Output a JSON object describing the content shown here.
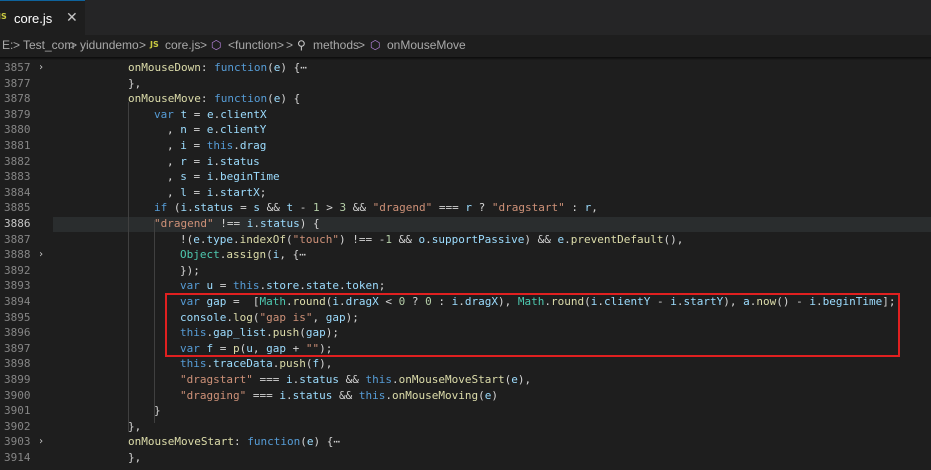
{
  "tab": {
    "badge": "JS",
    "label": "core.js",
    "close": "✕"
  },
  "breadcrumb": {
    "drive": "E:",
    "sep": ">",
    "folder1": "Test_com",
    "folder2": "yidundemo",
    "file_badge": "JS",
    "file": "core.js",
    "sym1": "<function>",
    "sym2": "methods",
    "sym3": "onMouseMove"
  },
  "lines": [
    {
      "n": "3857",
      "fold": "›",
      "code": "onMouseDown: function(e) {⋯"
    },
    {
      "n": "3877",
      "fold": "",
      "code": "},"
    },
    {
      "n": "3878",
      "fold": "",
      "code": "onMouseMove: function(e) {"
    },
    {
      "n": "3879",
      "fold": "",
      "code": "var t = e.clientX"
    },
    {
      "n": "3880",
      "fold": "",
      "code": ", n = e.clientY"
    },
    {
      "n": "3881",
      "fold": "",
      "code": ", i = this.drag"
    },
    {
      "n": "3882",
      "fold": "",
      "code": ", r = i.status"
    },
    {
      "n": "3883",
      "fold": "",
      "code": ", s = i.beginTime"
    },
    {
      "n": "3884",
      "fold": "",
      "code": ", l = i.startX;"
    },
    {
      "n": "3885",
      "fold": "",
      "code": "if (i.status = s && t - 1 > 3 && \"dragend\" === r ? \"dragstart\" : r,"
    },
    {
      "n": "3886",
      "fold": "",
      "code": "\"dragend\" !== i.status) {"
    },
    {
      "n": "3887",
      "fold": "",
      "code": "!(e.type.indexOf(\"touch\") !== -1 && o.supportPassive) && e.preventDefault(),"
    },
    {
      "n": "3888",
      "fold": "›",
      "code": "Object.assign(i, {⋯"
    },
    {
      "n": "3892",
      "fold": "",
      "code": "});"
    },
    {
      "n": "3893",
      "fold": "",
      "code": "var u = this.$store.state.token;"
    },
    {
      "n": "3894",
      "fold": "",
      "code": "var gap =  [Math.round(i.dragX < 0 ? 0 : i.dragX), Math.round(i.clientY - i.startY), a.now() - i.beginTime];"
    },
    {
      "n": "3895",
      "fold": "",
      "code": "console.log(\"gap is\", gap);"
    },
    {
      "n": "3896",
      "fold": "",
      "code": "this.gap_list.push(gap);"
    },
    {
      "n": "3897",
      "fold": "",
      "code": "var f = p(u, gap + \"\");"
    },
    {
      "n": "3898",
      "fold": "",
      "code": "this.traceData.push(f),"
    },
    {
      "n": "3899",
      "fold": "",
      "code": "\"dragstart\" === i.status && this.onMouseMoveStart(e),"
    },
    {
      "n": "3900",
      "fold": "",
      "code": "\"dragging\" === i.status && this.onMouseMoving(e)"
    },
    {
      "n": "3901",
      "fold": "",
      "code": "}"
    },
    {
      "n": "3902",
      "fold": "",
      "code": "},"
    },
    {
      "n": "3903",
      "fold": "›",
      "code": "onMouseMoveStart: function(e) {⋯"
    },
    {
      "n": "3914",
      "fold": "",
      "code": "},"
    }
  ],
  "colors": {
    "keyword": "#569cd6",
    "string": "#ce9178",
    "number": "#b5cea8",
    "function": "#dcdcaa",
    "property": "#9cdcfe",
    "annotation_box": "#e02020"
  }
}
